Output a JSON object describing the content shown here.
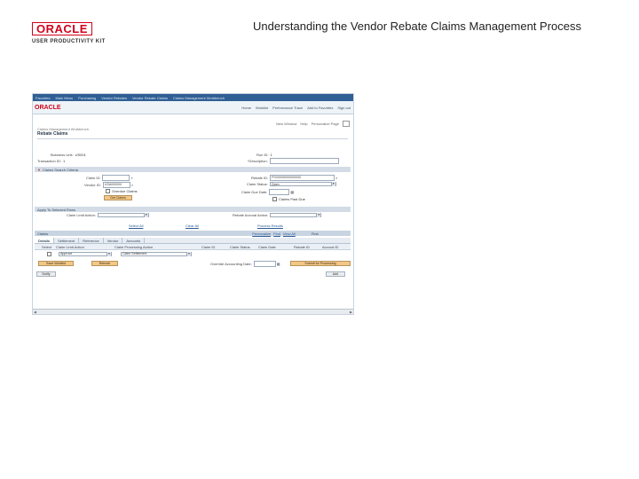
{
  "header": {
    "logo_main": "ORACLE",
    "logo_sub": "USER PRODUCTIVITY KIT",
    "doc_title": "Understanding the Vendor Rebate Claims Management Process"
  },
  "app": {
    "topbar": [
      "Favorites",
      "Main Menu",
      "Purchasing",
      "Vendor Rebates",
      "Vendor Rebate Claims",
      "Claims Management Workbench"
    ],
    "brand": "ORACLE",
    "navlinks": [
      "Home",
      "Worklist",
      "Performance Trace",
      "Add to Favorites",
      "Sign out"
    ],
    "crumbline": [
      "New Window",
      "Help",
      "Personalize Page"
    ],
    "page_subtitle": "Claims Management Workbench",
    "page_title": "Rebate Claims",
    "fields": {
      "business_unit_label": "Business Unit:",
      "business_unit_value": "US001",
      "transaction_id_label": "Transaction ID:",
      "transaction_id_value": "1",
      "run_id_label": "Run ID:",
      "run_id_value": "1",
      "description_label": "*Description:"
    },
    "claims_search": {
      "section_title": "Claims Search Criteria",
      "claim_id_label": "Claim ID:",
      "rebate_id_label": "Rebate ID:",
      "rebate_id_value": "PO00000000000000",
      "vendor_id_label": "Vendor ID:",
      "vendor_id_value": "USA000000",
      "claim_status_label": "Claim Status:",
      "claim_status_value": "Open",
      "overdue_label": "Overdue Claims",
      "claim_due_date_label": "Claim Due Date:",
      "claims_past_due_label": "Claims Past Due",
      "search_button": "Get Claims"
    },
    "apply_section": {
      "section_title": "Apply To Selected Rows",
      "claim_action_label": "Claim Limit Action:",
      "rebate_action_label": "Rebate Accrual Action:"
    },
    "links": {
      "select_all": "Select All",
      "clear_all": "Clear All",
      "process_results": "Process Results",
      "personalize": "Personalize",
      "find": "Find",
      "view_all": "View All",
      "first": "First"
    },
    "grid": {
      "title": "Claims",
      "tabs": [
        "Details",
        "Settlement",
        "Reference",
        "Vendor",
        "Amounts"
      ],
      "columns": [
        "Select",
        "Claim Limit Action",
        "Claim Processing Action",
        "Claim ID",
        "Claim Status",
        "Claim Date",
        "Rebate ID",
        "Accrual ID"
      ],
      "row": {
        "limit_action": "Approve",
        "processing_action": "Claim Settlement"
      }
    },
    "bottom": {
      "save_button": "Save Worklist",
      "refresh_button": "Refresh",
      "accounting_date_label": "Override Accounting Date:",
      "submit_button": "Submit for Processing",
      "notify_button": "Notify",
      "add_button": "Add"
    }
  }
}
